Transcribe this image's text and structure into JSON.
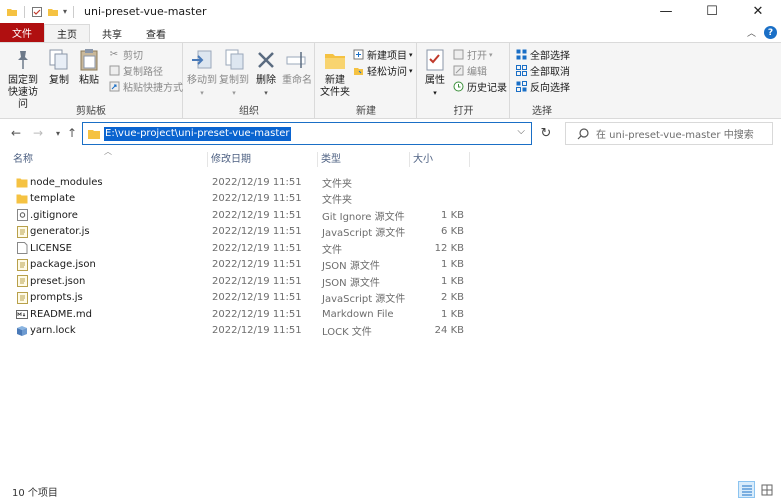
{
  "window": {
    "title": "uni-preset-vue-master",
    "minimize": "—",
    "maximize": "☐",
    "close": "✕"
  },
  "tabs": [
    {
      "label": "文件",
      "kind": "file"
    },
    {
      "label": "主页",
      "kind": "active"
    },
    {
      "label": "共享",
      "kind": "normal"
    },
    {
      "label": "查看",
      "kind": "normal"
    }
  ],
  "ribbon": {
    "clipboard": {
      "group_label": "剪贴板",
      "pin_l1": "固定到",
      "pin_l2": "快速访问",
      "copy": "复制",
      "paste": "粘贴",
      "cut": "剪切",
      "copy_path": "复制路径",
      "paste_shortcut": "粘贴快捷方式"
    },
    "organize": {
      "group_label": "组织",
      "move_to": "移动到",
      "copy_to": "复制到",
      "delete": "删除",
      "rename": "重命名"
    },
    "new": {
      "group_label": "新建",
      "new_folder_l1": "新建",
      "new_folder_l2": "文件夹",
      "new_item": "新建项目",
      "easy_access": "轻松访问"
    },
    "open": {
      "group_label": "打开",
      "properties": "属性",
      "open": "打开",
      "edit": "编辑",
      "history": "历史记录"
    },
    "select": {
      "group_label": "选择",
      "select_all": "全部选择",
      "select_none": "全部取消",
      "invert": "反向选择"
    }
  },
  "address": {
    "path": "E:\\vue-project\\uni-preset-vue-master",
    "search_placeholder": "在 uni-preset-vue-master 中搜索"
  },
  "columns": {
    "name": "名称",
    "modified": "修改日期",
    "type": "类型",
    "size": "大小"
  },
  "files": [
    {
      "name": "node_modules",
      "modified": "2022/12/19 11:51",
      "type": "文件夹",
      "size": "",
      "icon": "folder-icon"
    },
    {
      "name": "template",
      "modified": "2022/12/19 11:51",
      "type": "文件夹",
      "size": "",
      "icon": "folder-icon"
    },
    {
      "name": ".gitignore",
      "modified": "2022/12/19 11:51",
      "type": "Git Ignore 源文件",
      "size": "1 KB",
      "icon": "gear-file-icon"
    },
    {
      "name": "generator.js",
      "modified": "2022/12/19 11:51",
      "type": "JavaScript 源文件",
      "size": "6 KB",
      "icon": "js-file-icon"
    },
    {
      "name": "LICENSE",
      "modified": "2022/12/19 11:51",
      "type": "文件",
      "size": "12 KB",
      "icon": "blank-file-icon"
    },
    {
      "name": "package.json",
      "modified": "2022/12/19 11:51",
      "type": "JSON 源文件",
      "size": "1 KB",
      "icon": "json-file-icon"
    },
    {
      "name": "preset.json",
      "modified": "2022/12/19 11:51",
      "type": "JSON 源文件",
      "size": "1 KB",
      "icon": "json-file-icon"
    },
    {
      "name": "prompts.js",
      "modified": "2022/12/19 11:51",
      "type": "JavaScript 源文件",
      "size": "2 KB",
      "icon": "js-file-icon"
    },
    {
      "name": "README.md",
      "modified": "2022/12/19 11:51",
      "type": "Markdown File",
      "size": "1 KB",
      "icon": "markdown-file-icon"
    },
    {
      "name": "yarn.lock",
      "modified": "2022/12/19 11:51",
      "type": "LOCK 文件",
      "size": "24 KB",
      "icon": "lock-file-icon"
    }
  ],
  "status": {
    "item_count": "10 个项目"
  },
  "colors": {
    "file_tab": "#b00f10",
    "accent": "#1a6fc6",
    "selection": "#0a64d0",
    "folder": "#f5c242"
  }
}
